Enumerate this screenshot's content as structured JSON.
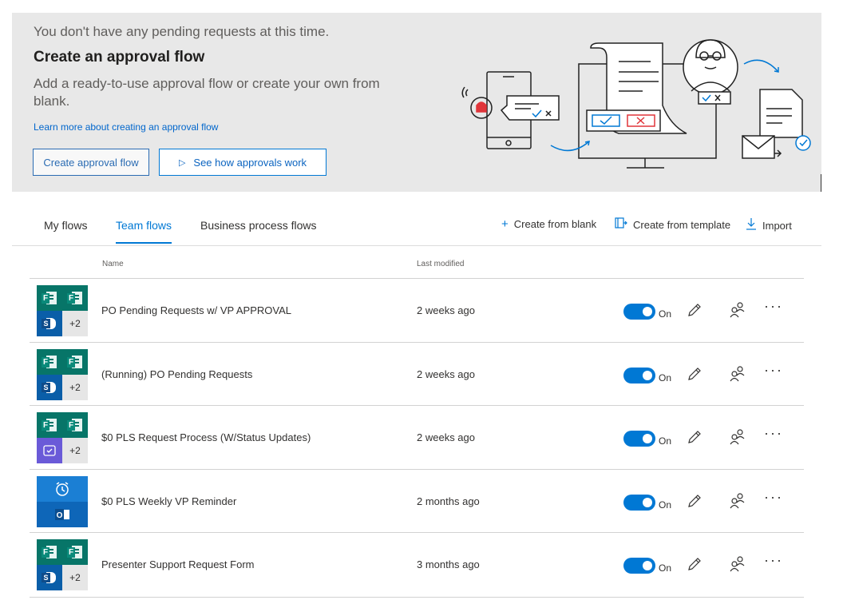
{
  "banner": {
    "pending_text": "You don't have any pending requests at this time.",
    "title": "Create an approval flow",
    "description": "Add a ready-to-use approval flow or create your own from blank.",
    "learn_more_link": "Learn more about creating an approval flow",
    "create_button": "Create approval flow",
    "see_how_button": "See how approvals work"
  },
  "tabs": [
    {
      "label": "My flows"
    },
    {
      "label": "Team flows",
      "active": true
    },
    {
      "label": "Business process flows"
    }
  ],
  "actions": {
    "create_blank": "Create from blank",
    "create_template": "Create from template",
    "import": "Import"
  },
  "columns": {
    "name": "Name",
    "modified": "Last modified"
  },
  "flows": [
    {
      "name": "PO Pending Requests w/ VP APPROVAL",
      "modified": "2 weeks ago",
      "status": "On",
      "icons": [
        "forms",
        "forms",
        "sharepoint"
      ],
      "extra": "+2"
    },
    {
      "name": "(Running) PO Pending Requests",
      "modified": "2 weeks ago",
      "status": "On",
      "icons": [
        "forms",
        "forms",
        "sharepoint"
      ],
      "extra": "+2"
    },
    {
      "name": "$0 PLS Request Process (W/Status Updates)",
      "modified": "2 weeks ago",
      "status": "On",
      "icons": [
        "forms",
        "forms",
        "approvals"
      ],
      "extra": "+2"
    },
    {
      "name": "$0 PLS Weekly VP Reminder",
      "modified": "2 months ago",
      "status": "On",
      "icons": [
        "recurrence",
        "outlook"
      ],
      "extra": ""
    },
    {
      "name": "Presenter Support Request Form",
      "modified": "3 months ago",
      "status": "On",
      "icons": [
        "forms",
        "forms",
        "sharepoint"
      ],
      "extra": "+2"
    }
  ],
  "colors": {
    "accent": "#0078d4",
    "forms": "#077568",
    "sharepoint": "#0a5ea8",
    "approvals": "#6a5ad8",
    "recurrence": "#1b7fd4"
  }
}
